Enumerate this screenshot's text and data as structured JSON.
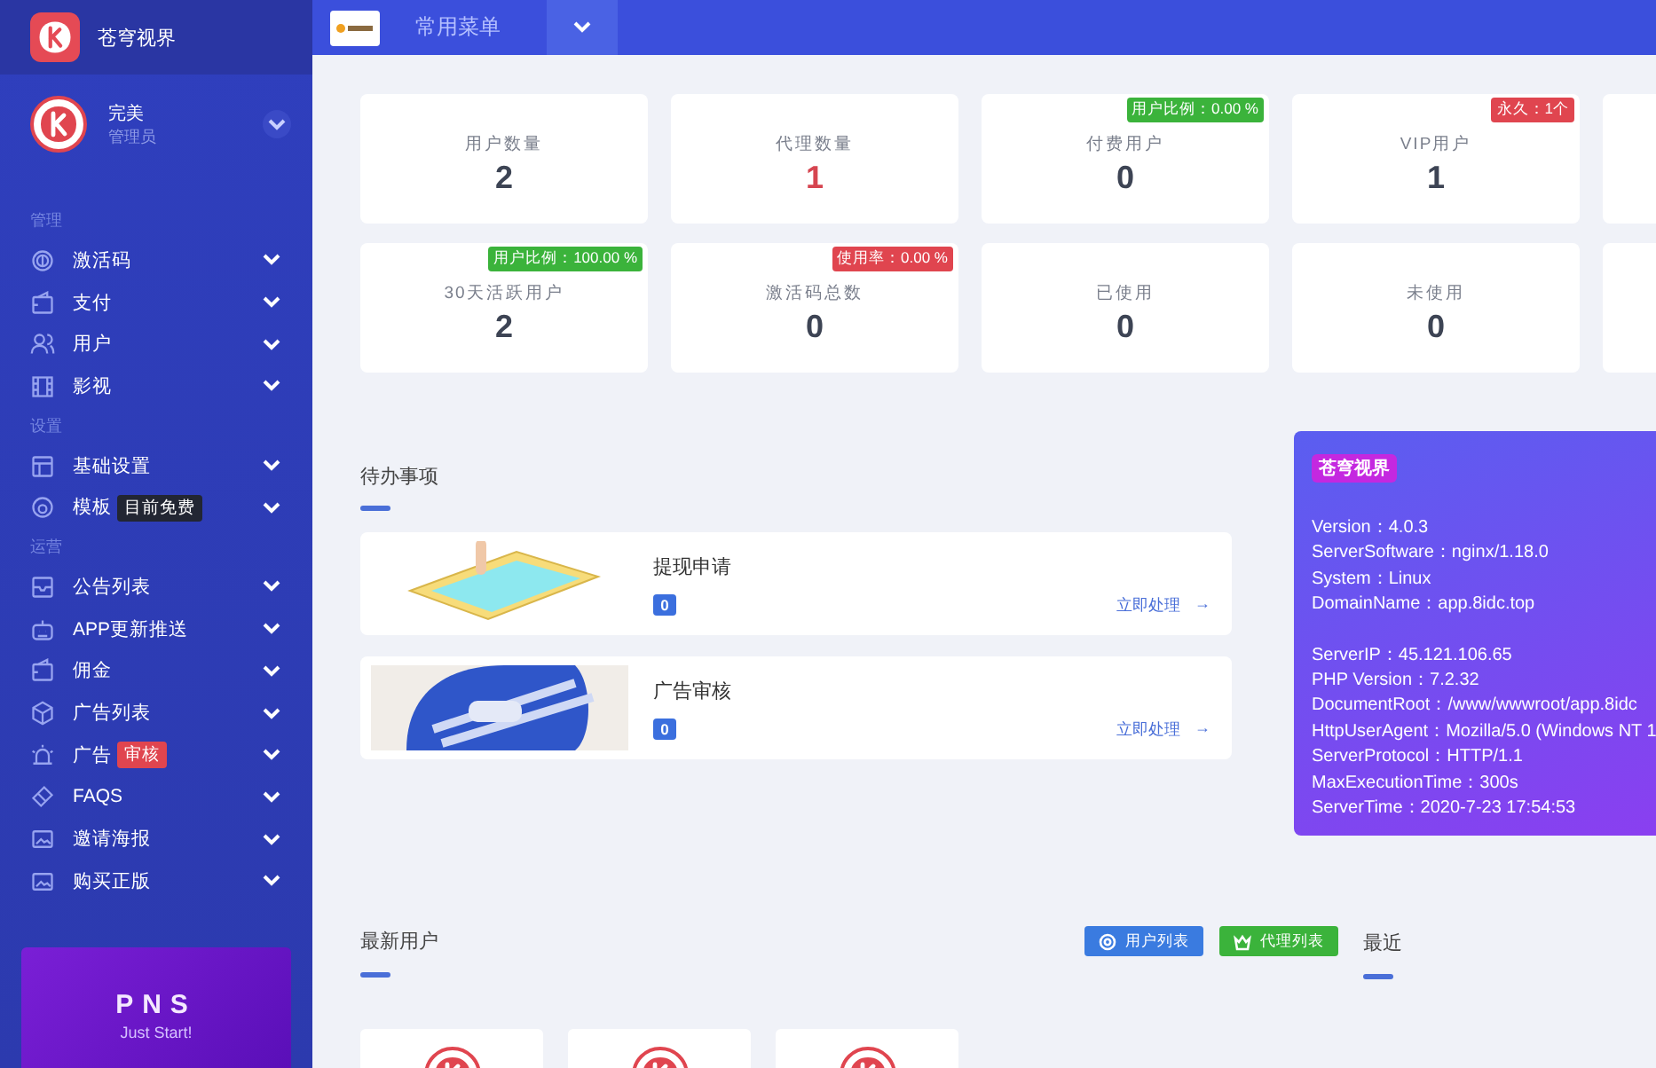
{
  "brand": {
    "name": "苍穹视界"
  },
  "user": {
    "name": "完美",
    "role": "管理员"
  },
  "sidebar": {
    "sections": [
      {
        "title": "管理",
        "items": [
          {
            "label": "激活码"
          },
          {
            "label": "支付"
          },
          {
            "label": "用户"
          },
          {
            "label": "影视"
          }
        ]
      },
      {
        "title": "设置",
        "items": [
          {
            "label": "基础设置"
          },
          {
            "label": "模板",
            "tag": {
              "text": "目前免费",
              "color": "#222633"
            }
          }
        ]
      },
      {
        "title": "运营",
        "items": [
          {
            "label": "公告列表"
          },
          {
            "label": "APP更新推送"
          },
          {
            "label": "佣金"
          },
          {
            "label": "广告列表"
          },
          {
            "label": "广告",
            "tag": {
              "text": "审核",
              "color": "#e0454f"
            }
          },
          {
            "label": "FAQS"
          },
          {
            "label": "邀请海报"
          },
          {
            "label": "购买正版"
          }
        ]
      }
    ]
  },
  "promo": {
    "title": "PNS",
    "subtitle": "Just Start!"
  },
  "header": {
    "menu_title": "常用菜单"
  },
  "stats": [
    {
      "label": "用户数量",
      "value": "2",
      "accent": false
    },
    {
      "label": "代理数量",
      "value": "1",
      "accent": true
    },
    {
      "label": "付费用户",
      "value": "0",
      "accent": false,
      "badge": {
        "text": "用户比例：0.00 %",
        "color": "#3bb33b"
      }
    },
    {
      "label": "VIP用户",
      "value": "1",
      "accent": false,
      "badge": {
        "text": "永久：1个",
        "color": "#e0454f"
      }
    },
    {
      "label": "30天活跃用户",
      "value": "2",
      "accent": false,
      "badge": {
        "text": "用户比例：100.00 %",
        "color": "#3bb33b"
      }
    },
    {
      "label": "激活码总数",
      "value": "0",
      "accent": false,
      "badge": {
        "text": "使用率：0.00 %",
        "color": "#e0454f"
      }
    },
    {
      "label": "已使用",
      "value": "0",
      "accent": false
    },
    {
      "label": "未使用",
      "value": "0",
      "accent": false
    }
  ],
  "todo": {
    "title": "待办事项",
    "items": [
      {
        "kind": "phone",
        "title": "提现申请",
        "count": "0",
        "action": "立即处理",
        "arrow": "→"
      },
      {
        "kind": "station",
        "title": "广告审核",
        "count": "0",
        "action": "立即处理",
        "arrow": "→"
      }
    ]
  },
  "server_info": {
    "title": "苍穹视界",
    "groups": [
      [
        "Version：4.0.3",
        "ServerSoftware：nginx/1.18.0",
        "System：Linux",
        "DomainName：app.8idc.top"
      ],
      [
        "ServerIP：45.121.106.65",
        "PHP Version：7.2.32",
        "DocumentRoot：/www/wwwroot/app.8idc",
        "HttpUserAgent：Mozilla/5.0 (Windows NT 1",
        "ServerProtocol：HTTP/1.1",
        "MaxExecutionTime：300s",
        "ServerTime：2020-7-23 17:54:53"
      ]
    ]
  },
  "latest_users": {
    "title": "最新用户",
    "buttons": [
      {
        "label": "用户列表",
        "color": "#3a7be0"
      },
      {
        "label": "代理列表",
        "color": "#3bb33b"
      }
    ],
    "cards": [
      {
        "kind": "logo-avatar"
      },
      {
        "kind": "logo-avatar"
      },
      {
        "kind": "logo-avatar"
      }
    ]
  },
  "recent": {
    "title": "最近"
  }
}
